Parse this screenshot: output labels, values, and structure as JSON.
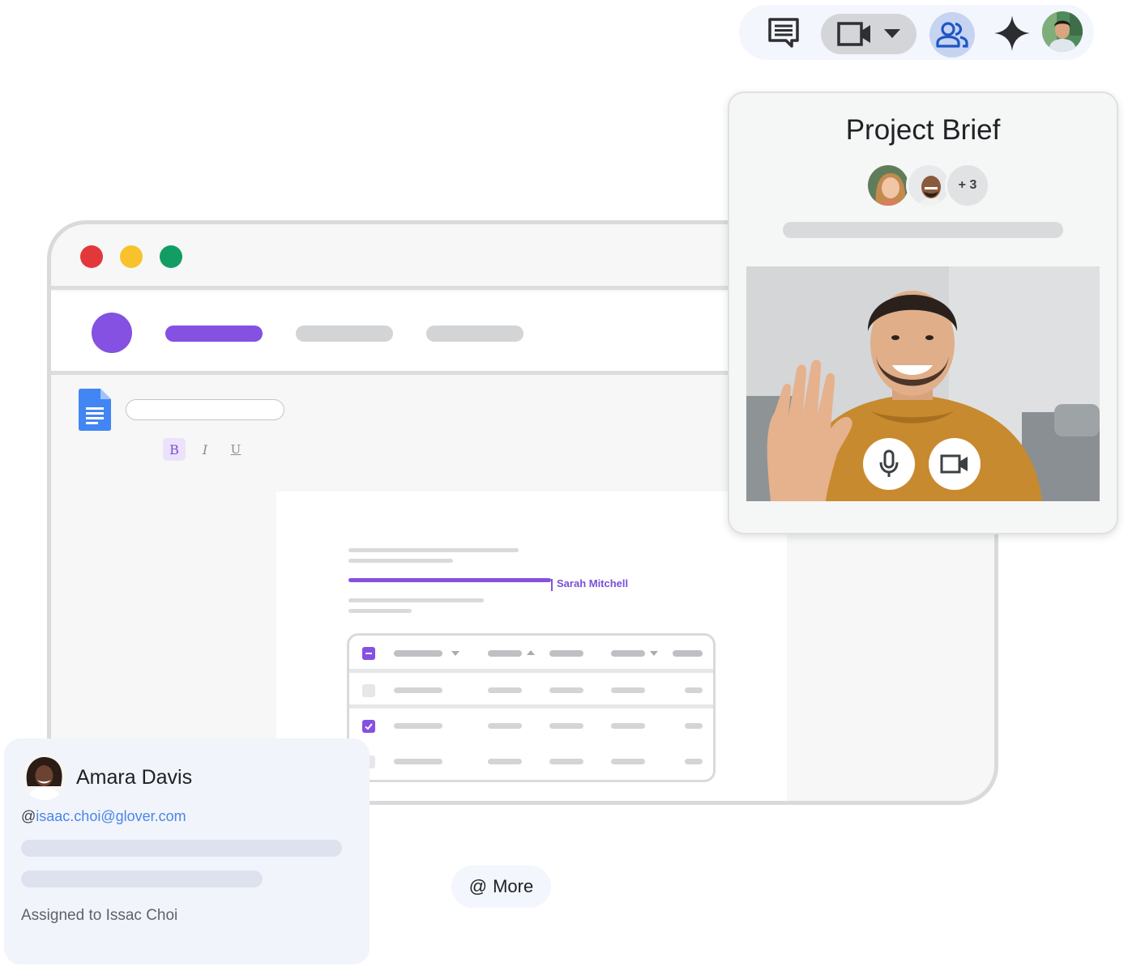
{
  "toolbar": {
    "icons": [
      "chat-icon",
      "video-camera-icon",
      "chevron-down-icon",
      "people-icon",
      "sparkle-icon",
      "user-avatar"
    ]
  },
  "window": {
    "traffic_lights": [
      "#e2383a",
      "#f8c22c",
      "#119d63"
    ],
    "accent_color": "#8451e2"
  },
  "editor": {
    "format_buttons": {
      "bold": "B",
      "italic": "I",
      "underline": "U"
    },
    "collaborator_cursor": "Sarah Mitchell"
  },
  "call": {
    "title": "Project Brief",
    "extra_participants": "+ 3",
    "controls": [
      "mic-icon",
      "camera-icon"
    ]
  },
  "contact": {
    "name": "Amara Davis",
    "mention_prefix": "@",
    "email": "isaac.choi@glover.com",
    "assigned": "Assigned to Issac Choi"
  },
  "more_chip": {
    "prefix": "@",
    "label": "More"
  }
}
